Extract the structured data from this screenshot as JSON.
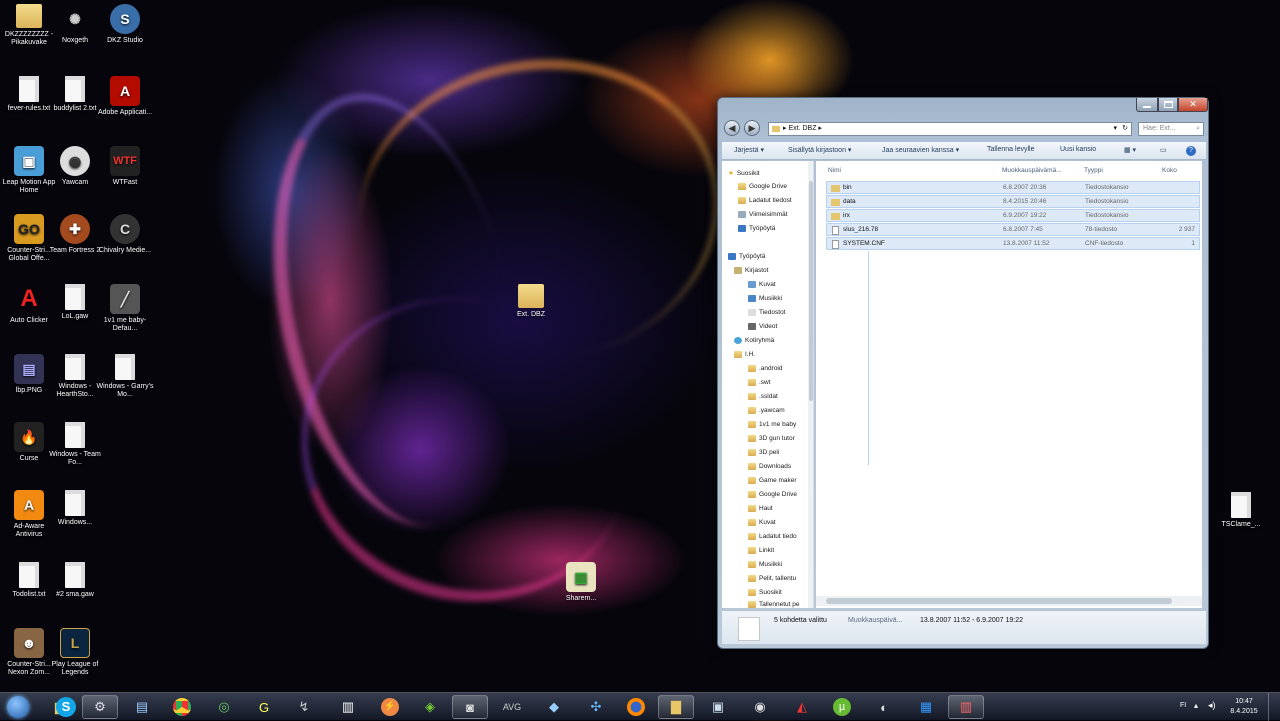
{
  "desktop_icons": [
    {
      "label": "DKZZZZZZZZ - Pikakuvake",
      "icon": "folder-shortcut-icon"
    },
    {
      "label": "Noxgeth",
      "icon": "app-icon"
    },
    {
      "label": "DKZ Studio",
      "icon": "app-icon"
    },
    {
      "label": "fever-rules.txt",
      "icon": "document-icon"
    },
    {
      "label": "buddylist 2.txt",
      "icon": "document-icon"
    },
    {
      "label": "Adobe Applicati...",
      "icon": "adobe-icon"
    },
    {
      "label": "Leap Motion App Home",
      "icon": "leap-motion-icon"
    },
    {
      "label": "Yawcam",
      "icon": "webcam-icon"
    },
    {
      "label": "WTFast",
      "icon": "wtfast-icon"
    },
    {
      "label": "Counter-Stri... Global Offe...",
      "icon": "csgo-icon"
    },
    {
      "label": "Team Fortress 2",
      "icon": "tf2-icon"
    },
    {
      "label": "Chivalry Medie...",
      "icon": "chivalry-icon"
    },
    {
      "label": "Auto Clicker",
      "icon": "auto-clicker-icon"
    },
    {
      "label": "LoL.gaw",
      "icon": "image-file-icon"
    },
    {
      "label": "1v1 me baby-Defau...",
      "icon": "app-icon"
    },
    {
      "label": "lbp.PNG",
      "icon": "image-file-icon"
    },
    {
      "label": "Windows - HearthSto...",
      "icon": "image-file-icon"
    },
    {
      "label": "Windows - Garry's Mo...",
      "icon": "image-file-icon"
    },
    {
      "label": "Curse",
      "icon": "curse-icon"
    },
    {
      "label": "Windows - Team Fo...",
      "icon": "image-file-icon"
    },
    {
      "label": "Ad-Aware Antivirus",
      "icon": "ad-aware-icon"
    },
    {
      "label": "Windows...",
      "icon": "image-file-icon"
    },
    {
      "label": "Todolist.txt",
      "icon": "document-icon"
    },
    {
      "label": "#2 sma.gaw",
      "icon": "image-file-icon"
    },
    {
      "label": "Counter-Stri... Nexon Zom...",
      "icon": "cs-nexon-icon"
    },
    {
      "label": "Play League of Legends",
      "icon": "league-icon"
    },
    {
      "label": "Ext. DBZ",
      "icon": "folder-icon"
    },
    {
      "label": "Sharem...",
      "icon": "archive-icon"
    },
    {
      "label": "TSClame_...",
      "icon": "document-icon"
    }
  ],
  "explorer": {
    "address": "Ext. DBZ",
    "search_placeholder": "Hae: Ext...",
    "toolbar": {
      "organize": "Järjestä",
      "include": "Sisällytä kirjastoon",
      "share": "Jaa seuraavien kanssa",
      "burn": "Tallenna levylle",
      "new_folder": "Uusi kansio"
    },
    "nav": [
      "Suosikit",
      "Google Drive",
      "Ladatut tiedost",
      "Viimeisimmät",
      "Työpöytä",
      "Työpöytä",
      "Kirjastot",
      "Kuvat",
      "Musiikki",
      "Tiedostot",
      "Videot",
      "Kotiryhmä",
      "I.H.",
      ".android",
      ".swt",
      ".ssldat",
      ".yawcam",
      "1v1 me baby",
      "3D gun tutor",
      "3D peli",
      "Downloads",
      "Game maker",
      "Google Drive",
      "Haut",
      "Kuvat",
      "Ladatut tiedo",
      "Linkit",
      "Musiikki",
      "Pelit, tallentu",
      "Suosikit",
      "Tallennetut pe"
    ],
    "columns": {
      "name": "Nimi",
      "modified": "Muokkauspäivämä...",
      "type": "Tyyppi",
      "size": "Koko"
    },
    "rows": [
      {
        "name": "bin",
        "modified": "6.8.2007 20:36",
        "type": "Tiedostokansio",
        "size": ""
      },
      {
        "name": "data",
        "modified": "8.4.2015 20:46",
        "type": "Tiedostokansio",
        "size": ""
      },
      {
        "name": "irx",
        "modified": "6.9.2007 19:22",
        "type": "Tiedostokansio",
        "size": ""
      },
      {
        "name": "slus_216.78",
        "modified": "6.8.2007 7:45",
        "type": "78-tiedosto",
        "size": "2 937"
      },
      {
        "name": "SYSTEM.CNF",
        "modified": "13.8.2007 11:52",
        "type": "CNF-tiedosto",
        "size": "1"
      }
    ],
    "status": {
      "selected": "5 kohdetta valittu",
      "modified_label": "Muokkauspäivä...",
      "modified_range": "13.8.2007 11:52 - 6.9.2007 19:22"
    }
  },
  "taskbar": {
    "apps": [
      "start",
      "windows-explorer",
      "skype",
      "steam",
      "file-manager",
      "chrome",
      "xbox",
      "garena",
      "steam-app",
      "app",
      "league",
      "media",
      "nvidia",
      "terminal",
      "launcher",
      "arrow",
      "network",
      "firefox",
      "explorer-window",
      "app-window",
      "game",
      "dart",
      "utorrent",
      "fraps",
      "monitor",
      "multi"
    ],
    "tray_lang": "FI",
    "time": "10:47",
    "date": "8.4.2015"
  },
  "colors": {
    "selection_bg": "#dde9f7",
    "selection_border": "#b7d1ee",
    "folder": "#e5c56e"
  }
}
